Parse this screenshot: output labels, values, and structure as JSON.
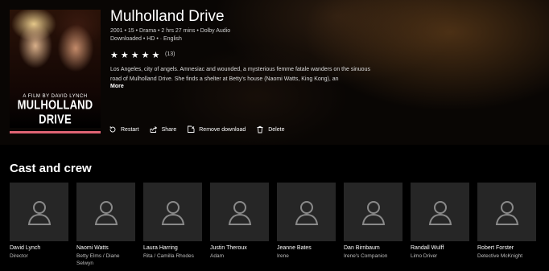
{
  "movie": {
    "title": "Mulholland Drive",
    "meta_line1": "2001 • 15 • Drama • 2 hrs 27 mins • Dolby Audio",
    "meta_line2": "Downloaded • HD • · English",
    "rating_stars": "★★★★★",
    "rating_count": "(13)",
    "description": "Los Angeles, city of angels. Amnesiac and wounded, a mysterious femme fatale wanders on the sinuous road of Mulholland Drive. She finds a shelter at Betty's house (Naomi Watts, King Kong), an",
    "more_label": "More",
    "poster_credit": "A FILM BY DAVID LYNCH",
    "poster_title": "MULHOLLAND DRIVE",
    "progress": 1.0
  },
  "actions": {
    "restart": "Restart",
    "share": "Share",
    "remove_download": "Remove download",
    "delete": "Delete"
  },
  "cast_section": {
    "title": "Cast and crew",
    "people": [
      {
        "name": "David Lynch",
        "role": "Director"
      },
      {
        "name": "Naomi Watts",
        "role": "Betty Elms / Diane Selwyn"
      },
      {
        "name": "Laura Harring",
        "role": "Rita / Camilla Rhodes"
      },
      {
        "name": "Justin Theroux",
        "role": "Adam"
      },
      {
        "name": "Jeanne Bates",
        "role": "Irene"
      },
      {
        "name": "Dan Birnbaum",
        "role": "Irene's Companion"
      },
      {
        "name": "Randall Wulff",
        "role": "Limo Driver"
      },
      {
        "name": "Robert Forster",
        "role": "Detective McKnight"
      }
    ]
  },
  "colors": {
    "progress_accent": "#e06474",
    "placeholder_bg": "#262626"
  },
  "icons": [
    "restart-icon",
    "share-icon",
    "remove-download-icon",
    "delete-icon",
    "person-placeholder-icon"
  ]
}
